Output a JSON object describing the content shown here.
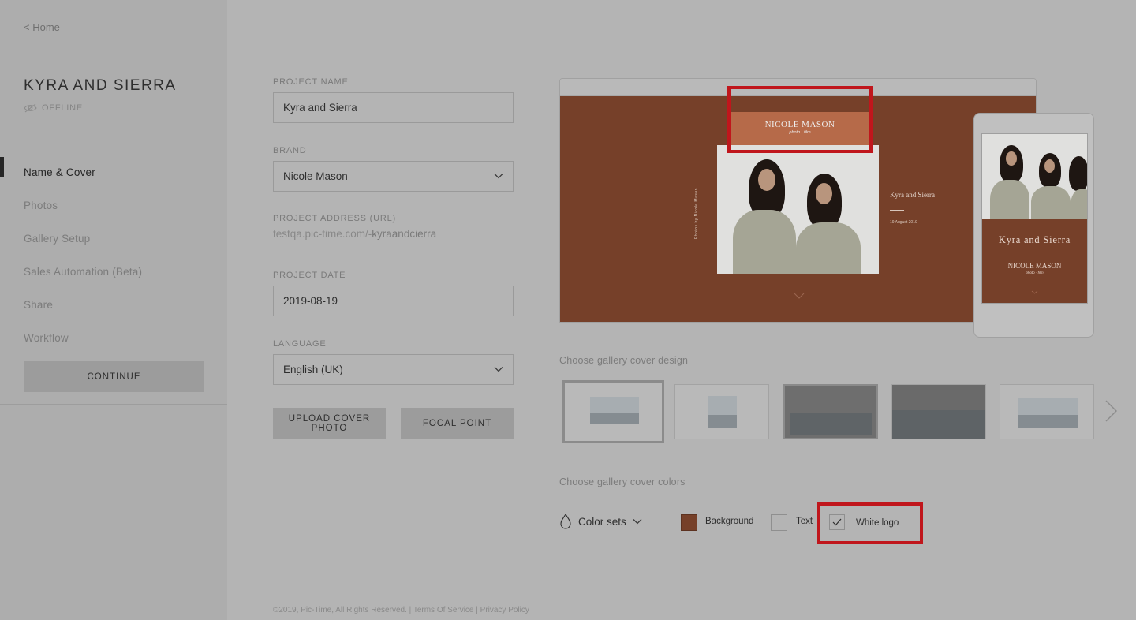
{
  "sidebar": {
    "home_link": "< Home",
    "project_title": "KYRA AND SIERRA",
    "status": "OFFLINE",
    "nav": [
      "Name & Cover",
      "Photos",
      "Gallery Setup",
      "Sales Automation (Beta)",
      "Share",
      "Workflow"
    ],
    "active_index": 0,
    "continue": "CONTINUE"
  },
  "form": {
    "project_name_label": "PROJECT NAME",
    "project_name": "Kyra and Sierra",
    "brand_label": "BRAND",
    "brand": "Nicole Mason",
    "address_label": "PROJECT ADDRESS (URL)",
    "address_prefix": "testqa.pic-time.com/-",
    "address_slug": "kyraandcierra",
    "date_label": "PROJECT DATE",
    "date": "2019-08-19",
    "language_label": "LANGUAGE",
    "language": "English (UK)",
    "upload_button": "UPLOAD COVER PHOTO",
    "focal_button": "FOCAL POINT"
  },
  "preview": {
    "logo": "NICOLE MASON",
    "logo_sub": "photo · film",
    "side_title": "Kyra and Sierra",
    "side_date": "19 August 2019",
    "vertical_credit": "Photos by   Nicole Mason",
    "mobile_title": "Kyra and Sierra",
    "mobile_logo": "NICOLE MASON",
    "mobile_logo_sub": "photo · film"
  },
  "cover_design": {
    "label": "Choose gallery cover design",
    "thumbnail_count": 5,
    "selected_index": 0
  },
  "cover_colors": {
    "label": "Choose gallery cover colors",
    "color_sets": "Color sets",
    "background_label": "Background",
    "background_color": "#764029",
    "text_label": "Text",
    "text_color": "#b4b4b4",
    "white_logo_label": "White logo",
    "white_logo_checked": true
  },
  "footer": {
    "text": "©2019, Pic-Time, All Rights Reserved. | Terms Of Service | Privacy Policy"
  },
  "colors": {
    "highlight": "#c0161c",
    "cover_bg": "#764029",
    "logo_block": "#b66a49"
  }
}
